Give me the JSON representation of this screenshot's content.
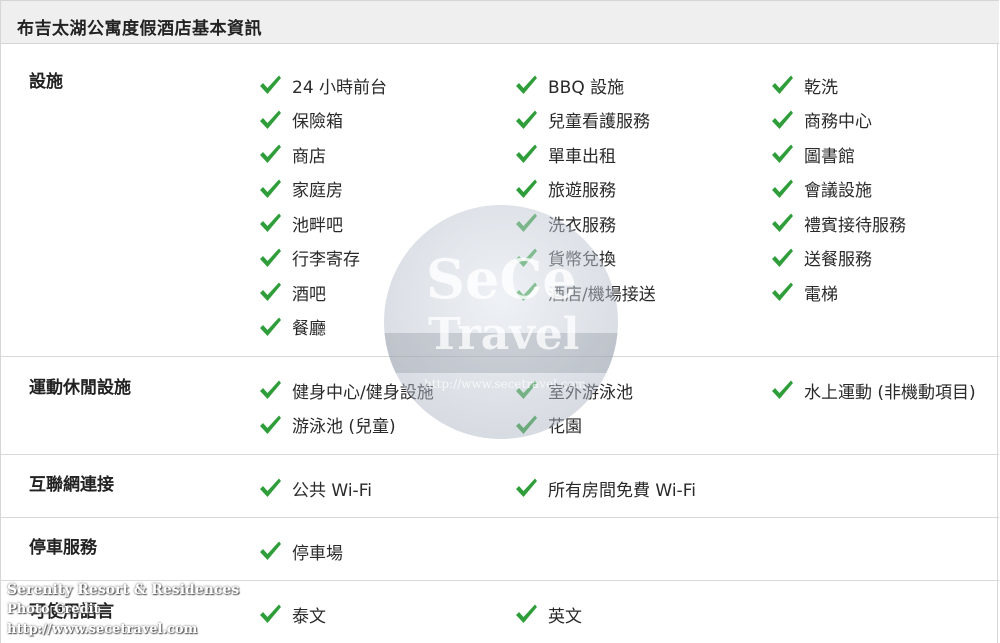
{
  "title": "布吉太湖公寓度假酒店基本資訊",
  "check_color": "#2f9e3a",
  "check_icon": "check-icon",
  "sections": [
    {
      "label": "設施",
      "items": [
        "24 小時前台",
        "BBQ 設施",
        "乾洗",
        "保險箱",
        "兒童看護服務",
        "商務中心",
        "商店",
        "單車出租",
        "圖書館",
        "家庭房",
        "旅遊服務",
        "會議設施",
        "池畔吧",
        "洗衣服務",
        "禮賓接待服務",
        "行李寄存",
        "貨幣兌換",
        "送餐服務",
        "酒吧",
        "酒店/機場接送",
        "電梯",
        "餐廳"
      ]
    },
    {
      "label": "運動休閒設施",
      "items": [
        "健身中心/健身設施",
        "室外游泳池",
        "水上運動 (非機動項目)",
        "游泳池 (兒童)",
        "花園"
      ]
    },
    {
      "label": "互聯網連接",
      "items": [
        "公共 Wi-Fi",
        "所有房間免費 Wi-Fi"
      ]
    },
    {
      "label": "停車服務",
      "items": [
        "停車場"
      ]
    },
    {
      "label": "可使用語言",
      "items": [
        "泰文",
        "英文"
      ]
    }
  ],
  "watermark": {
    "line1": "SeCe",
    "line2": "Travel",
    "line3": "http://www.secetravel.com"
  },
  "corner_watermark": {
    "line1": "Serenity Resort & Residences",
    "line2": "Photo Credit",
    "line3": "http://www.secetravel.com"
  }
}
